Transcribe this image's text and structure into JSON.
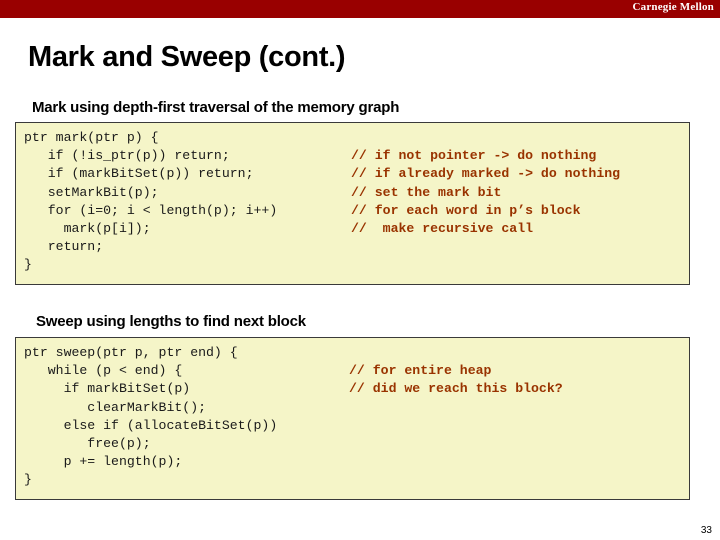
{
  "banner": {
    "brand": "Carnegie Mellon",
    "color": "#990000"
  },
  "slide": {
    "title": "Mark and Sweep (cont.)",
    "page_number": "33"
  },
  "sections": [
    {
      "heading": "Mark using depth-first traversal of the memory graph",
      "code_background": "#f5f5c8",
      "comment_color": "#993300",
      "lines": [
        {
          "code": "ptr mark(ptr p) {",
          "comment": ""
        },
        {
          "code": "   if (!is_ptr(p)) return;",
          "comment": "// if not pointer -> do nothing"
        },
        {
          "code": "   if (markBitSet(p)) return;",
          "comment": "// if already marked -> do nothing"
        },
        {
          "code": "   setMarkBit(p);",
          "comment": "// set the mark bit"
        },
        {
          "code": "   for (i=0; i < length(p); i++)",
          "comment": "// for each word in p’s block"
        },
        {
          "code": "     mark(p[i]);",
          "comment": "//  make recursive call"
        },
        {
          "code": "   return;",
          "comment": ""
        },
        {
          "code": "}",
          "comment": ""
        }
      ]
    },
    {
      "heading": "Sweep using lengths to find next block",
      "code_background": "#f5f5c8",
      "comment_color": "#993300",
      "lines": [
        {
          "code": "ptr sweep(ptr p, ptr end) {",
          "comment": ""
        },
        {
          "code": "   while (p < end) {",
          "comment": "// for entire heap"
        },
        {
          "code": "     if markBitSet(p)",
          "comment": "// did we reach this block?"
        },
        {
          "code": "        clearMarkBit();",
          "comment": ""
        },
        {
          "code": "     else if (allocateBitSet(p))",
          "comment": ""
        },
        {
          "code": "        free(p);",
          "comment": ""
        },
        {
          "code": "     p += length(p);",
          "comment": ""
        },
        {
          "code": "}",
          "comment": ""
        }
      ]
    }
  ]
}
